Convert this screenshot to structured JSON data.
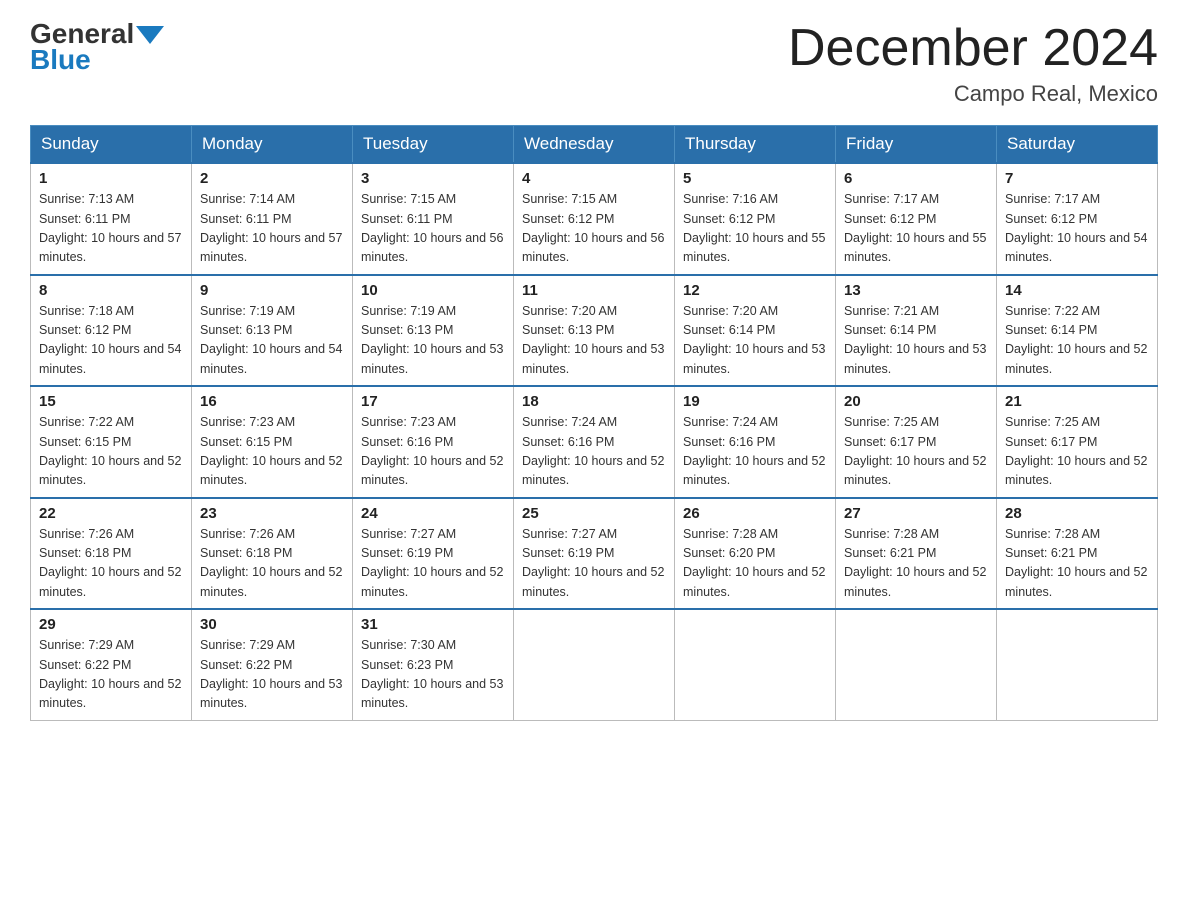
{
  "header": {
    "logo_general": "General",
    "logo_blue": "Blue",
    "month_title": "December 2024",
    "location": "Campo Real, Mexico"
  },
  "days_of_week": [
    "Sunday",
    "Monday",
    "Tuesday",
    "Wednesday",
    "Thursday",
    "Friday",
    "Saturday"
  ],
  "weeks": [
    [
      {
        "day": "1",
        "sunrise": "7:13 AM",
        "sunset": "6:11 PM",
        "daylight": "10 hours and 57 minutes."
      },
      {
        "day": "2",
        "sunrise": "7:14 AM",
        "sunset": "6:11 PM",
        "daylight": "10 hours and 57 minutes."
      },
      {
        "day": "3",
        "sunrise": "7:15 AM",
        "sunset": "6:11 PM",
        "daylight": "10 hours and 56 minutes."
      },
      {
        "day": "4",
        "sunrise": "7:15 AM",
        "sunset": "6:12 PM",
        "daylight": "10 hours and 56 minutes."
      },
      {
        "day": "5",
        "sunrise": "7:16 AM",
        "sunset": "6:12 PM",
        "daylight": "10 hours and 55 minutes."
      },
      {
        "day": "6",
        "sunrise": "7:17 AM",
        "sunset": "6:12 PM",
        "daylight": "10 hours and 55 minutes."
      },
      {
        "day": "7",
        "sunrise": "7:17 AM",
        "sunset": "6:12 PM",
        "daylight": "10 hours and 54 minutes."
      }
    ],
    [
      {
        "day": "8",
        "sunrise": "7:18 AM",
        "sunset": "6:12 PM",
        "daylight": "10 hours and 54 minutes."
      },
      {
        "day": "9",
        "sunrise": "7:19 AM",
        "sunset": "6:13 PM",
        "daylight": "10 hours and 54 minutes."
      },
      {
        "day": "10",
        "sunrise": "7:19 AM",
        "sunset": "6:13 PM",
        "daylight": "10 hours and 53 minutes."
      },
      {
        "day": "11",
        "sunrise": "7:20 AM",
        "sunset": "6:13 PM",
        "daylight": "10 hours and 53 minutes."
      },
      {
        "day": "12",
        "sunrise": "7:20 AM",
        "sunset": "6:14 PM",
        "daylight": "10 hours and 53 minutes."
      },
      {
        "day": "13",
        "sunrise": "7:21 AM",
        "sunset": "6:14 PM",
        "daylight": "10 hours and 53 minutes."
      },
      {
        "day": "14",
        "sunrise": "7:22 AM",
        "sunset": "6:14 PM",
        "daylight": "10 hours and 52 minutes."
      }
    ],
    [
      {
        "day": "15",
        "sunrise": "7:22 AM",
        "sunset": "6:15 PM",
        "daylight": "10 hours and 52 minutes."
      },
      {
        "day": "16",
        "sunrise": "7:23 AM",
        "sunset": "6:15 PM",
        "daylight": "10 hours and 52 minutes."
      },
      {
        "day": "17",
        "sunrise": "7:23 AM",
        "sunset": "6:16 PM",
        "daylight": "10 hours and 52 minutes."
      },
      {
        "day": "18",
        "sunrise": "7:24 AM",
        "sunset": "6:16 PM",
        "daylight": "10 hours and 52 minutes."
      },
      {
        "day": "19",
        "sunrise": "7:24 AM",
        "sunset": "6:16 PM",
        "daylight": "10 hours and 52 minutes."
      },
      {
        "day": "20",
        "sunrise": "7:25 AM",
        "sunset": "6:17 PM",
        "daylight": "10 hours and 52 minutes."
      },
      {
        "day": "21",
        "sunrise": "7:25 AM",
        "sunset": "6:17 PM",
        "daylight": "10 hours and 52 minutes."
      }
    ],
    [
      {
        "day": "22",
        "sunrise": "7:26 AM",
        "sunset": "6:18 PM",
        "daylight": "10 hours and 52 minutes."
      },
      {
        "day": "23",
        "sunrise": "7:26 AM",
        "sunset": "6:18 PM",
        "daylight": "10 hours and 52 minutes."
      },
      {
        "day": "24",
        "sunrise": "7:27 AM",
        "sunset": "6:19 PM",
        "daylight": "10 hours and 52 minutes."
      },
      {
        "day": "25",
        "sunrise": "7:27 AM",
        "sunset": "6:19 PM",
        "daylight": "10 hours and 52 minutes."
      },
      {
        "day": "26",
        "sunrise": "7:28 AM",
        "sunset": "6:20 PM",
        "daylight": "10 hours and 52 minutes."
      },
      {
        "day": "27",
        "sunrise": "7:28 AM",
        "sunset": "6:21 PM",
        "daylight": "10 hours and 52 minutes."
      },
      {
        "day": "28",
        "sunrise": "7:28 AM",
        "sunset": "6:21 PM",
        "daylight": "10 hours and 52 minutes."
      }
    ],
    [
      {
        "day": "29",
        "sunrise": "7:29 AM",
        "sunset": "6:22 PM",
        "daylight": "10 hours and 52 minutes."
      },
      {
        "day": "30",
        "sunrise": "7:29 AM",
        "sunset": "6:22 PM",
        "daylight": "10 hours and 53 minutes."
      },
      {
        "day": "31",
        "sunrise": "7:30 AM",
        "sunset": "6:23 PM",
        "daylight": "10 hours and 53 minutes."
      },
      null,
      null,
      null,
      null
    ]
  ]
}
